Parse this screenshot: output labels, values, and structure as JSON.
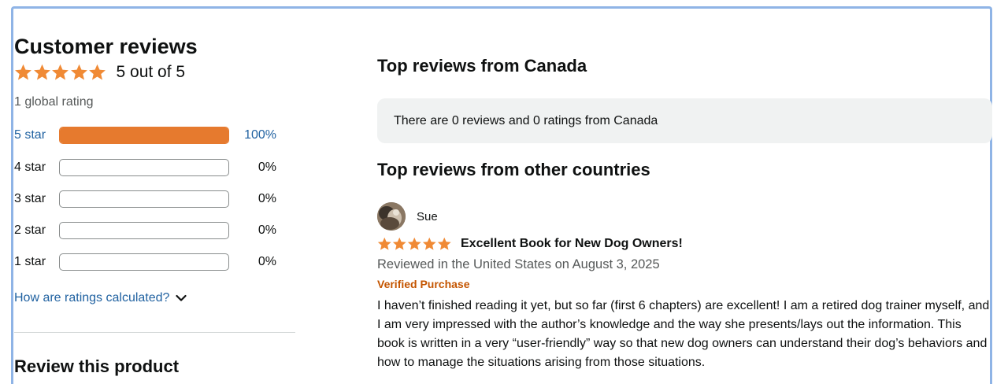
{
  "summary": {
    "title": "Customer reviews",
    "stars": 5,
    "rating_text": "5 out of 5",
    "global_rating": "1 global rating"
  },
  "histogram": [
    {
      "label": "5 star",
      "percent_text": "100%",
      "fraction": 1.0
    },
    {
      "label": "4 star",
      "percent_text": "0%",
      "fraction": 0
    },
    {
      "label": "3 star",
      "percent_text": "0%",
      "fraction": 0
    },
    {
      "label": "2 star",
      "percent_text": "0%",
      "fraction": 0
    },
    {
      "label": "1 star",
      "percent_text": "0%",
      "fraction": 0
    }
  ],
  "how_calculated": "How are ratings calculated?",
  "review_product_heading": "Review this product",
  "canada": {
    "heading": "Top reviews from Canada",
    "empty_message": "There are 0 reviews and 0 ratings from Canada"
  },
  "other": {
    "heading": "Top reviews from other countries",
    "review": {
      "author": "Sue",
      "stars": 5,
      "title": "Excellent Book for New Dog Owners!",
      "date": "Reviewed in the United States on August 3, 2025",
      "badge": "Verified Purchase",
      "body": "I haven’t finished reading it yet, but so far (first 6 chapters) are excellent! I am a retired dog trainer myself, and I am very impressed with the author’s knowledge and the way she presents/lays out the information. This book is written in a very “user-friendly” way so that new dog owners can understand their dog’s behaviors and how to manage the situations arising from those situations."
    }
  },
  "colors": {
    "star": "#f08a35",
    "bar_fill": "#e67a2e",
    "link": "#2162a1",
    "verified": "#c45500",
    "frame": "#8fb4e6"
  },
  "icons": {
    "star": "star-icon",
    "chevron": "chevron-down-icon"
  }
}
